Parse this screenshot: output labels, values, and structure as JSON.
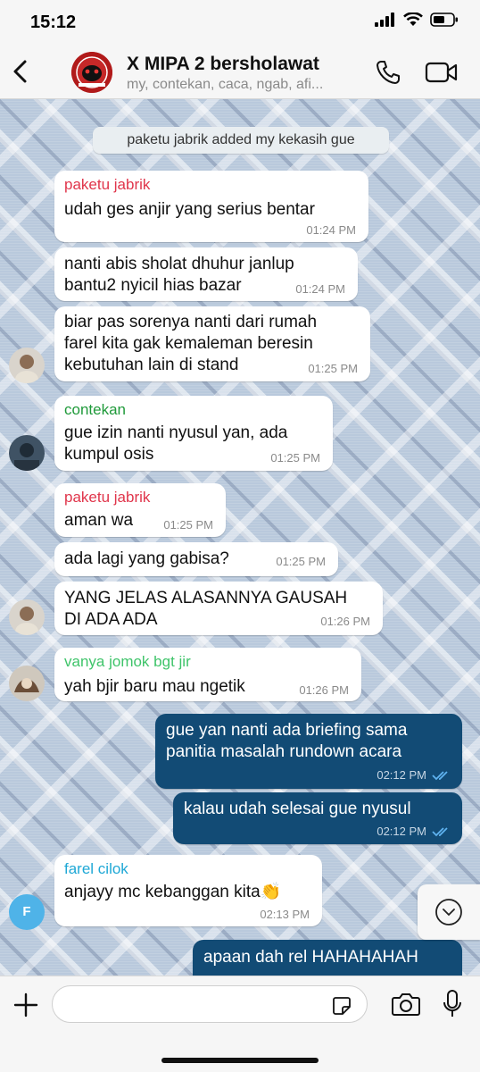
{
  "status_bar": {
    "time": "15:12"
  },
  "header": {
    "title": "X MIPA 2 bersholawat",
    "members": "my, contekan, caca, ngab, afi..."
  },
  "system_note": "paketu jabrik added my kekasih gue",
  "colors": {
    "outgoing": "#124b75",
    "sender_red": "#e0354b",
    "sender_green": "#1f9a3a",
    "sender_green2": "#3fc46a",
    "sender_cyan": "#1fa8d6"
  },
  "messages": [
    {
      "sender": "paketu jabrik",
      "lines": [
        "udah ges anjir yang serius bentar"
      ],
      "time": "01:24 PM"
    },
    {
      "lines": [
        "nanti abis sholat dhuhur janlup",
        "bantu2 nyicil hias bazar"
      ],
      "time": "01:24 PM"
    },
    {
      "lines": [
        "biar pas sorenya nanti dari rumah",
        "farel kita gak kemaleman beresin",
        "kebutuhan lain di stand"
      ],
      "time": "01:25 PM"
    },
    {
      "sender": "contekan",
      "lines": [
        "gue izin nanti nyusul yan, ada",
        "kumpul osis"
      ],
      "time": "01:25 PM"
    },
    {
      "sender": "paketu jabrik",
      "lines": [
        "aman wa"
      ],
      "time": "01:25 PM"
    },
    {
      "lines": [
        "ada lagi yang gabisa?"
      ],
      "time": "01:25 PM"
    },
    {
      "lines": [
        "YANG JELAS ALASANNYA GAUSAH",
        "DI ADA ADA"
      ],
      "time": "01:26 PM"
    },
    {
      "sender": "vanya jomok bgt jir",
      "lines": [
        "yah bjir baru mau ngetik"
      ],
      "time": "01:26 PM"
    },
    {
      "lines": [
        "gue yan nanti ada briefing sama",
        "panitia masalah rundown acara"
      ],
      "time": "02:12 PM"
    },
    {
      "lines": [
        "kalau udah selesai gue nyusul"
      ],
      "time": "02:12 PM"
    },
    {
      "sender": "farel cilok",
      "lines": [
        "anjayy mc kebanggan kita👏"
      ],
      "time": "02:13 PM"
    },
    {
      "lines": [
        "apaan dah rel HAHAHAHAH"
      ]
    }
  ],
  "avatar_initial": "F",
  "composer": {
    "placeholder": ""
  }
}
